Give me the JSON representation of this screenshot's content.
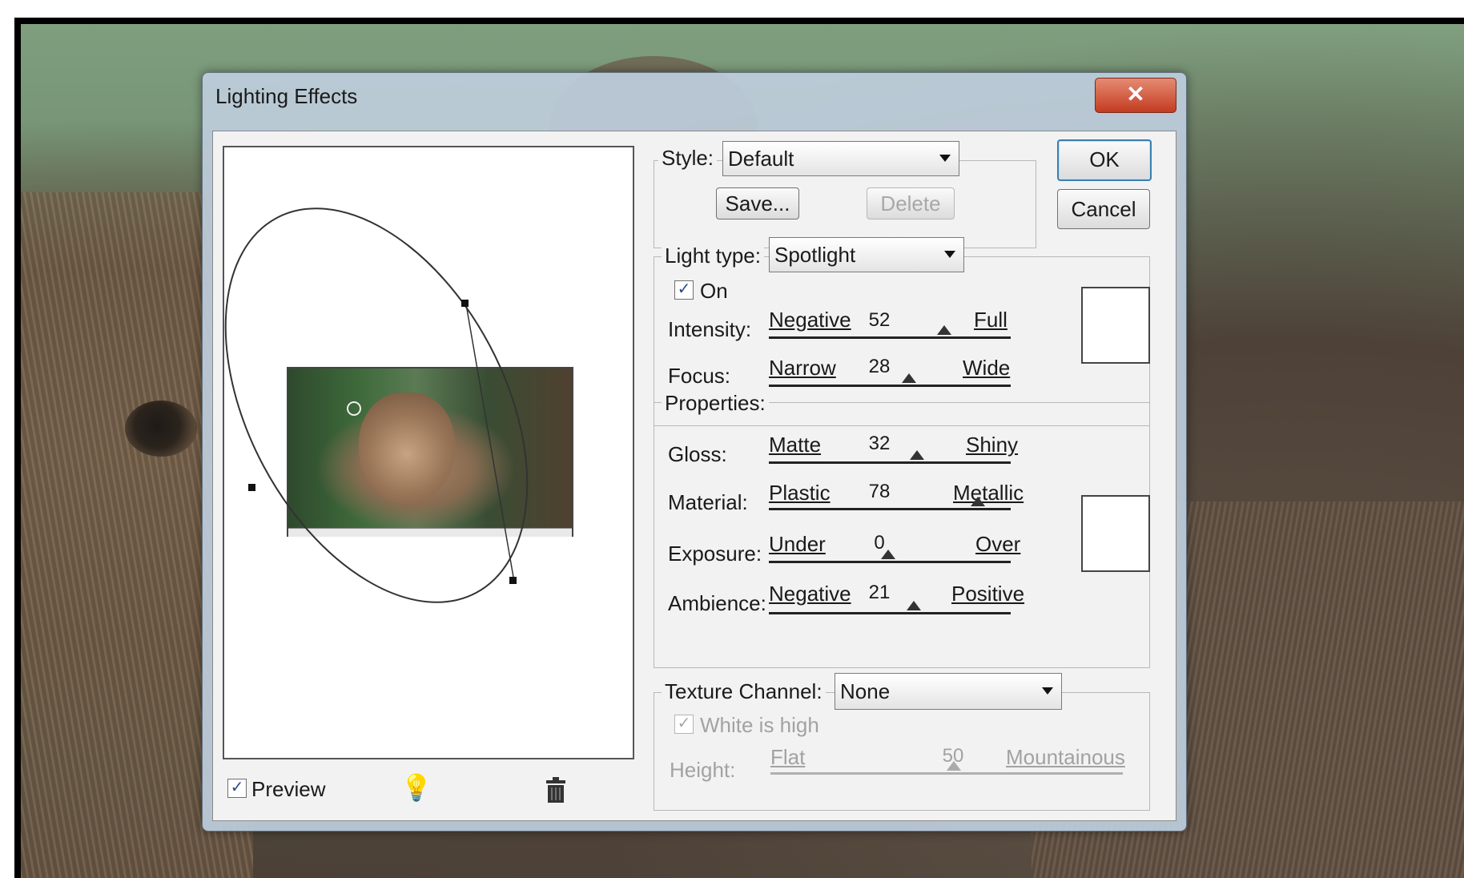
{
  "dialog": {
    "title": "Lighting Effects",
    "close_label": "✕",
    "ok_label": "OK",
    "cancel_label": "Cancel"
  },
  "style": {
    "label": "Style:",
    "value": "Default",
    "save_label": "Save...",
    "delete_label": "Delete"
  },
  "light": {
    "type_label": "Light type:",
    "type_value": "Spotlight",
    "on_label": "On",
    "on_checked": true,
    "intensity": {
      "label": "Intensity:",
      "left": "Negative",
      "right": "Full",
      "value": "52"
    },
    "focus": {
      "label": "Focus:",
      "left": "Narrow",
      "right": "Wide",
      "value": "28"
    }
  },
  "properties": {
    "heading": "Properties:",
    "gloss": {
      "label": "Gloss:",
      "left": "Matte",
      "right": "Shiny",
      "value": "32"
    },
    "material": {
      "label": "Material:",
      "left": "Plastic",
      "right": "Metallic",
      "value": "78"
    },
    "exposure": {
      "label": "Exposure:",
      "left": "Under",
      "right": "Over",
      "value": "0"
    },
    "ambience": {
      "label": "Ambience:",
      "left": "Negative",
      "right": "Positive",
      "value": "21"
    }
  },
  "texture": {
    "label": "Texture Channel:",
    "value": "None",
    "white_high_label": "White is high",
    "height": {
      "label": "Height:",
      "left": "Flat",
      "right": "Mountainous",
      "value": "50"
    }
  },
  "preview": {
    "label": "Preview",
    "checked": true
  },
  "icons": [
    "close-icon",
    "dropdown-arrow-icon",
    "checkmark-icon",
    "light-bulb-icon",
    "trash-icon"
  ]
}
